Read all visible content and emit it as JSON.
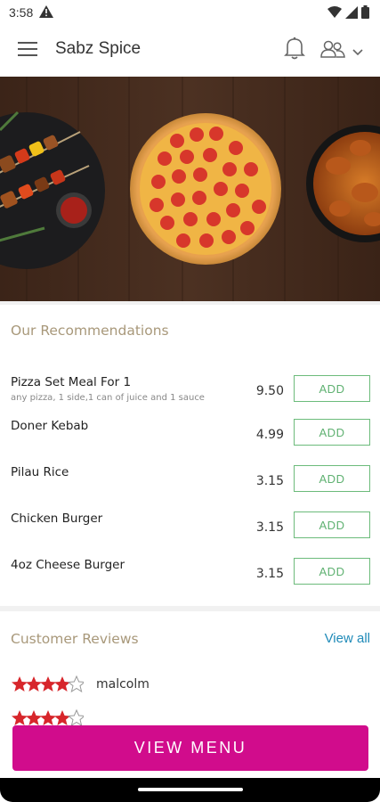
{
  "status": {
    "time": "3:58"
  },
  "header": {
    "title": "Sabz Spice"
  },
  "recommendations": {
    "title": "Our Recommendations",
    "items": [
      {
        "name": "Pizza Set Meal For 1",
        "desc": "any pizza, 1 side,1 can of juice and 1 sauce",
        "price": "9.50",
        "add": "ADD"
      },
      {
        "name": "Doner Kebab",
        "desc": "",
        "price": "4.99",
        "add": "ADD"
      },
      {
        "name": "Pilau Rice",
        "desc": "",
        "price": "3.15",
        "add": "ADD"
      },
      {
        "name": "Chicken Burger",
        "desc": "",
        "price": "3.15",
        "add": "ADD"
      },
      {
        "name": "4oz Cheese Burger",
        "desc": "",
        "price": "3.15",
        "add": "ADD"
      }
    ]
  },
  "reviews": {
    "title": "Customer Reviews",
    "view_all": "View all",
    "items": [
      {
        "name": "malcolm",
        "rating": 4
      },
      {
        "name": "",
        "rating": 4
      }
    ]
  },
  "cta": {
    "label": "VIEW MENU"
  },
  "colors": {
    "accent": "#d10c8c",
    "add_green": "#5fb171",
    "link": "#1f8ab8",
    "section_title": "#a8987a",
    "star": "#d7262b"
  }
}
